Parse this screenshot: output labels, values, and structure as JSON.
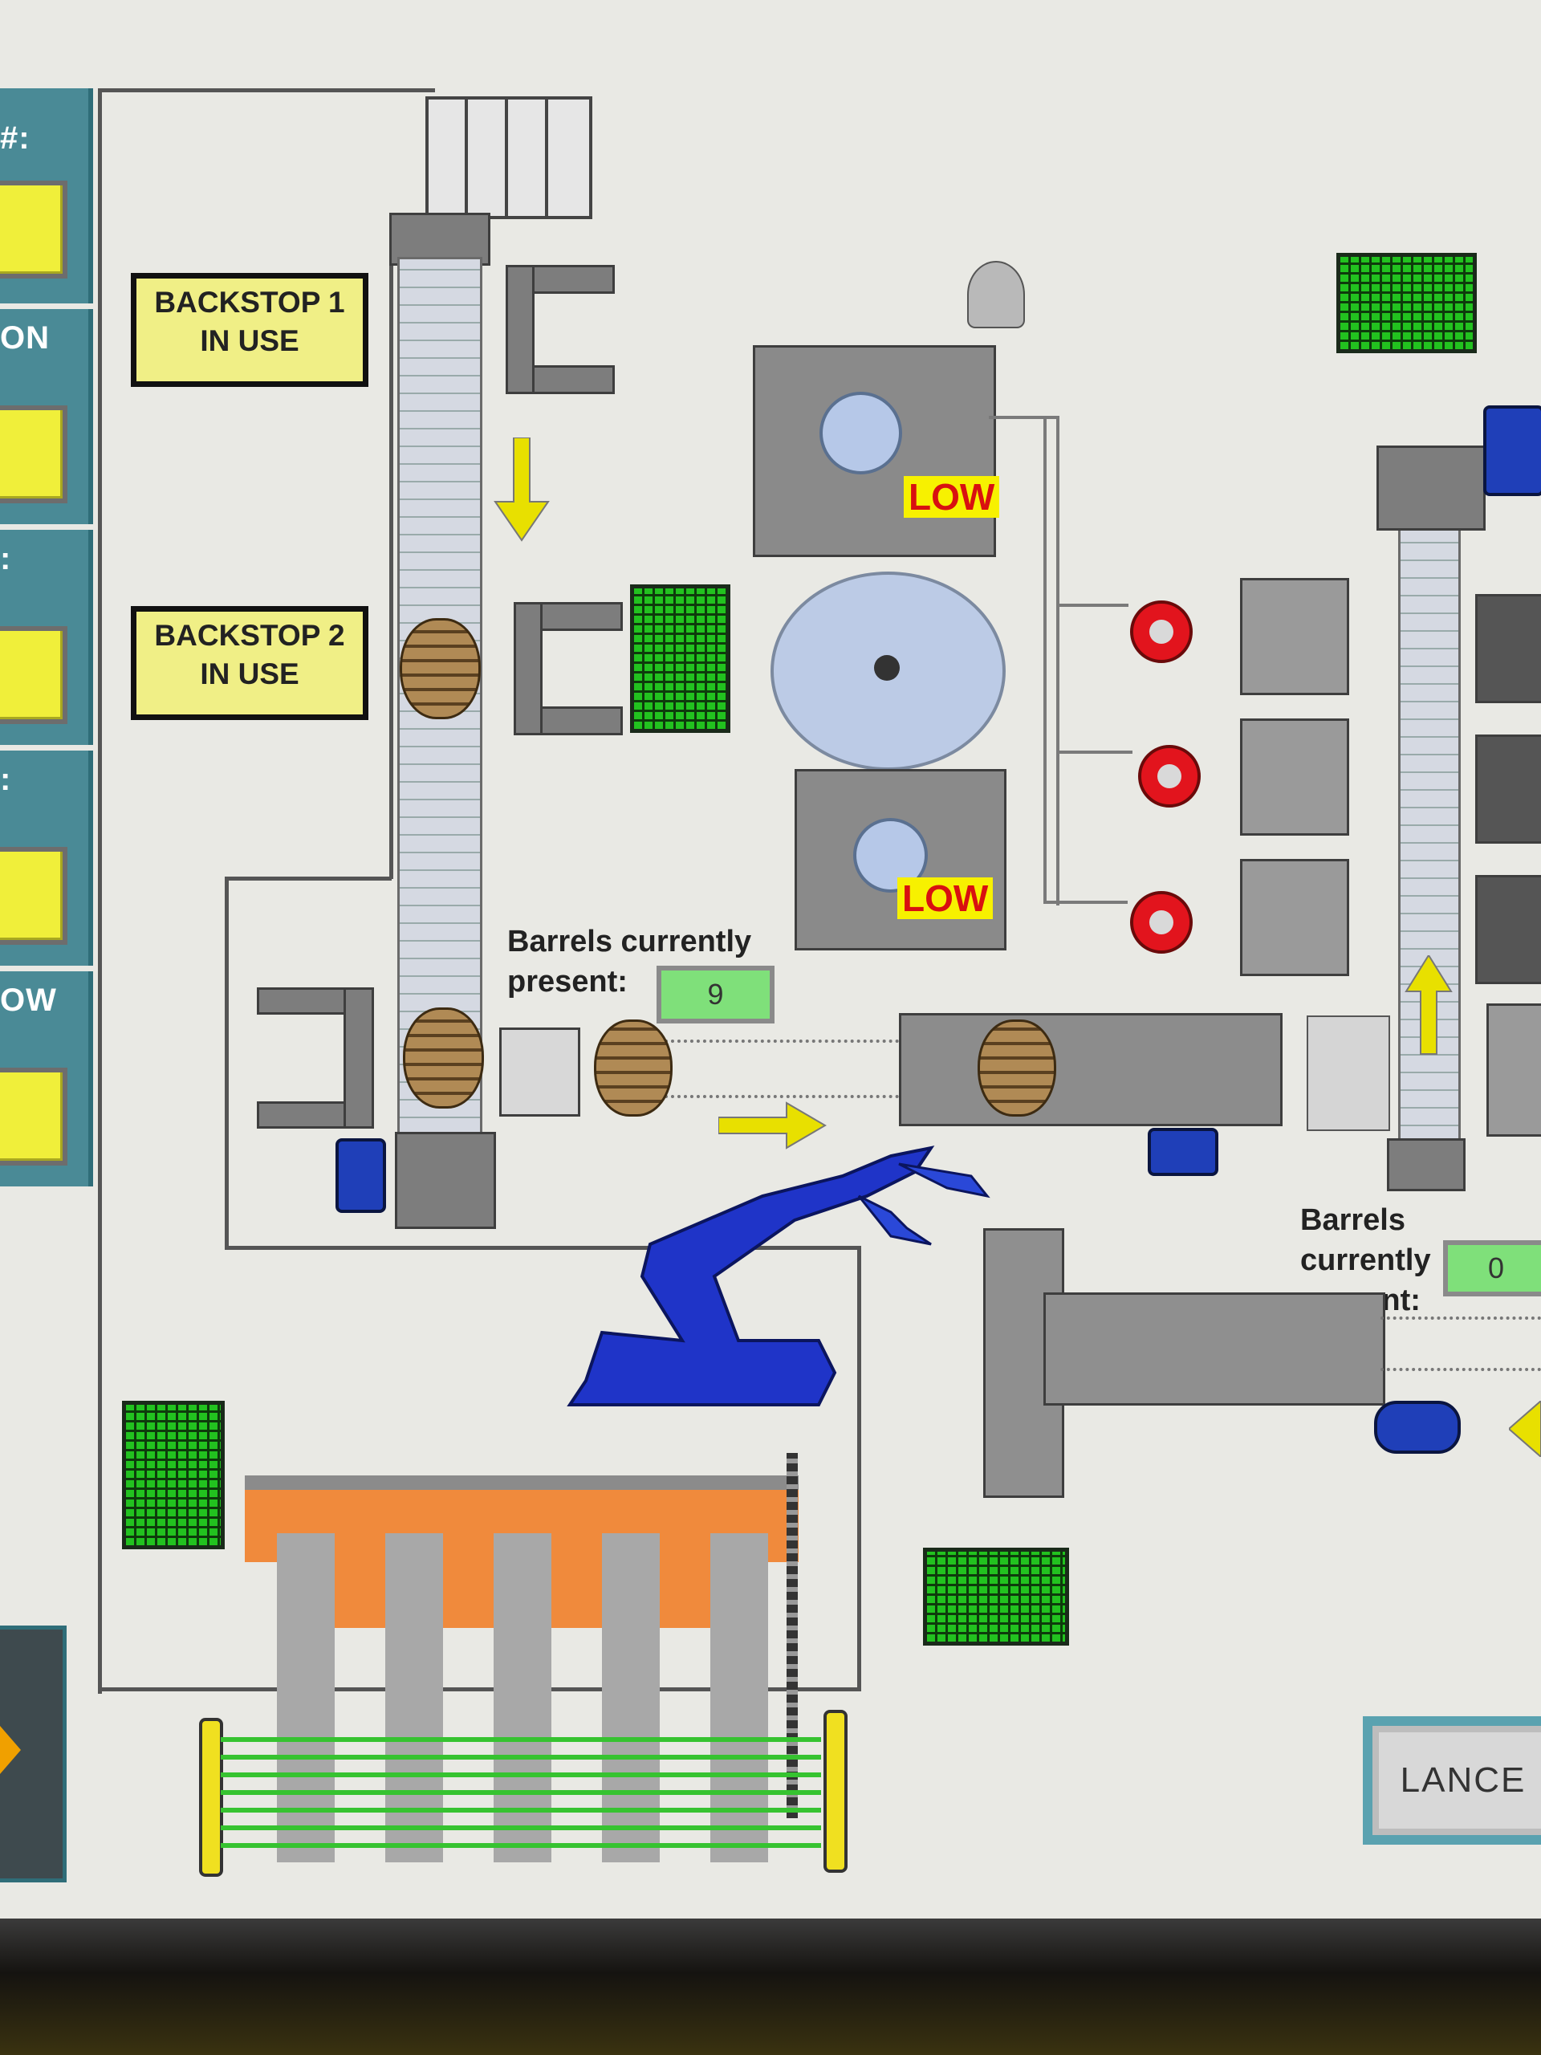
{
  "sidebar": {
    "labels": [
      "#:",
      "ON",
      ":",
      ":",
      "OW"
    ],
    "fields": [
      "",
      "",
      "",
      "",
      ""
    ]
  },
  "status": {
    "backstop1": [
      "BACKSTOP 1",
      "IN USE"
    ],
    "backstop2": [
      "BACKSTOP 2",
      "IN USE"
    ]
  },
  "hoppers": {
    "top_low": "LOW",
    "bottom_low": "LOW"
  },
  "counters": {
    "left_label_line1": "Barrels currently",
    "left_label_line2": "present:",
    "left_value": "9",
    "right_label_line1": "Barrels currently",
    "right_label_line2": "present:",
    "right_value": "0"
  },
  "buttons": {
    "lance": "LANCE"
  },
  "colors": {
    "screen_bg": "#e9e9e4",
    "panel_teal": "#4a8a96",
    "alarm_yellow": "#f7f100",
    "alarm_red": "#d81010",
    "status_ok_green": "#22c21f",
    "robot_blue": "#1f34c8",
    "fence_orange": "#f08a3c"
  }
}
